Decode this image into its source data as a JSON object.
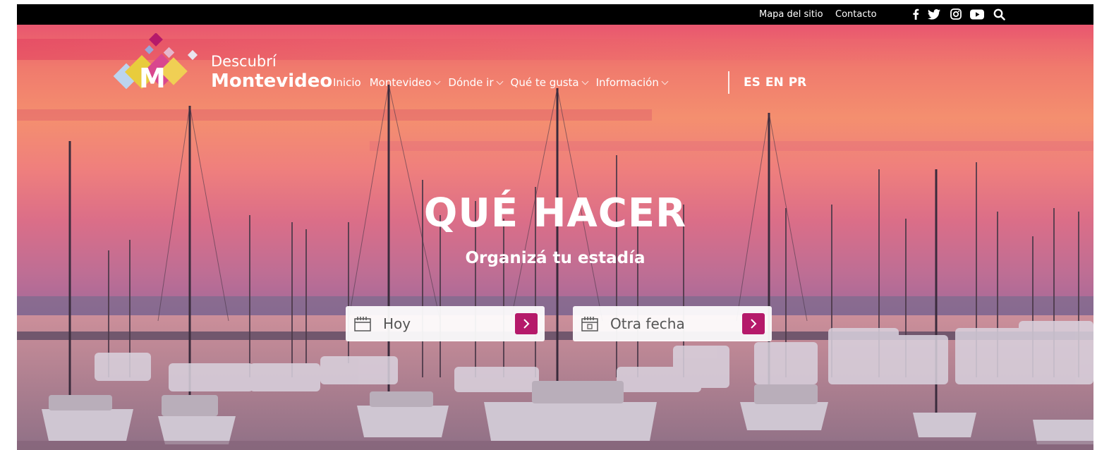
{
  "topbar": {
    "sitemap_label": "Mapa del sitio",
    "contact_label": "Contacto",
    "social_icons": [
      "facebook-icon",
      "twitter-icon",
      "instagram-icon",
      "youtube-icon",
      "search-icon"
    ]
  },
  "logo": {
    "line1": "Descubrí",
    "line2": "Montevideo",
    "mark_letter": "M"
  },
  "nav": {
    "items": [
      {
        "label": "Inicio",
        "has_dropdown": false
      },
      {
        "label": "Montevideo",
        "has_dropdown": true
      },
      {
        "label": "Dónde ir",
        "has_dropdown": true
      },
      {
        "label": "Qué te gusta",
        "has_dropdown": true
      },
      {
        "label": "Información",
        "has_dropdown": true
      }
    ],
    "languages": [
      "ES",
      "EN",
      "PR"
    ]
  },
  "hero": {
    "title": "QUÉ HACER",
    "subtitle": "Organizá tu estadía",
    "date_buttons": [
      {
        "label": "Hoy",
        "icon": "calendar-icon"
      },
      {
        "label": "Otra fecha",
        "icon": "calendar-icon"
      }
    ]
  },
  "colors": {
    "accent": "#b5196a",
    "topbar": "#000000"
  }
}
